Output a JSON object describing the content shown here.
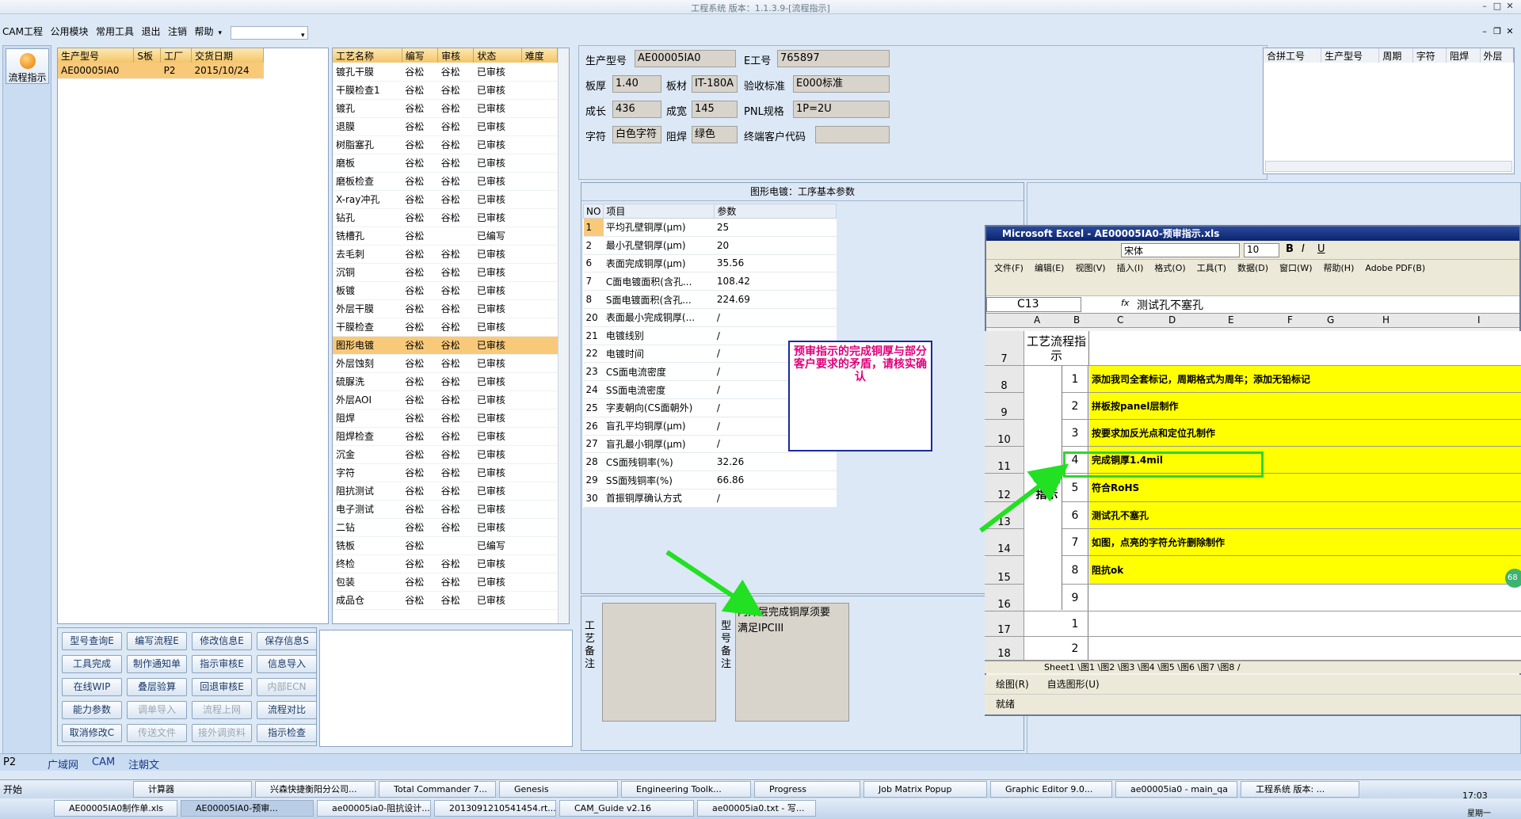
{
  "window": {
    "title": "工程系统 版本：1.1.3.9-[流程指示]"
  },
  "menu": {
    "items": [
      "CAM工程",
      "公用模块",
      "常用工具",
      "退出",
      "注销",
      "帮助"
    ]
  },
  "leftbar": {
    "flow_label": "流程指示"
  },
  "product_table": {
    "headers": [
      "生产型号",
      "S板",
      "工厂",
      "交货日期"
    ],
    "row": [
      "AE00005IA0",
      "",
      "P2",
      "2015/10/24"
    ]
  },
  "process_table": {
    "headers": [
      "工艺名称",
      "编写",
      "审核",
      "状态",
      "难度"
    ],
    "rows": [
      [
        "镀孔干膜",
        "谷松",
        "谷松",
        "已审核",
        ""
      ],
      [
        "干膜检查1",
        "谷松",
        "谷松",
        "已审核",
        ""
      ],
      [
        "镀孔",
        "谷松",
        "谷松",
        "已审核",
        ""
      ],
      [
        "退膜",
        "谷松",
        "谷松",
        "已审核",
        ""
      ],
      [
        "树脂塞孔",
        "谷松",
        "谷松",
        "已审核",
        ""
      ],
      [
        "磨板",
        "谷松",
        "谷松",
        "已审核",
        ""
      ],
      [
        "磨板检查",
        "谷松",
        "谷松",
        "已审核",
        ""
      ],
      [
        "X-ray冲孔",
        "谷松",
        "谷松",
        "已审核",
        ""
      ],
      [
        "钻孔",
        "谷松",
        "谷松",
        "已审核",
        ""
      ],
      [
        "铣槽孔",
        "谷松",
        "",
        "已编写",
        ""
      ],
      [
        "去毛刺",
        "谷松",
        "谷松",
        "已审核",
        ""
      ],
      [
        "沉铜",
        "谷松",
        "谷松",
        "已审核",
        ""
      ],
      [
        "板镀",
        "谷松",
        "谷松",
        "已审核",
        ""
      ],
      [
        "外层干膜",
        "谷松",
        "谷松",
        "已审核",
        ""
      ],
      [
        "干膜检查",
        "谷松",
        "谷松",
        "已审核",
        ""
      ],
      [
        "图形电镀",
        "谷松",
        "谷松",
        "已审核",
        ""
      ],
      [
        "外层蚀刻",
        "谷松",
        "谷松",
        "已审核",
        ""
      ],
      [
        "硫脲洗",
        "谷松",
        "谷松",
        "已审核",
        ""
      ],
      [
        "外层AOI",
        "谷松",
        "谷松",
        "已审核",
        ""
      ],
      [
        "阻焊",
        "谷松",
        "谷松",
        "已审核",
        ""
      ],
      [
        "阻焊检查",
        "谷松",
        "谷松",
        "已审核",
        ""
      ],
      [
        "沉金",
        "谷松",
        "谷松",
        "已审核",
        ""
      ],
      [
        "字符",
        "谷松",
        "谷松",
        "已审核",
        ""
      ],
      [
        "阻抗测试",
        "谷松",
        "谷松",
        "已审核",
        ""
      ],
      [
        "电子测试",
        "谷松",
        "谷松",
        "已审核",
        ""
      ],
      [
        "二钻",
        "谷松",
        "谷松",
        "已审核",
        ""
      ],
      [
        "铣板",
        "谷松",
        "",
        "已编写",
        ""
      ],
      [
        "终检",
        "谷松",
        "谷松",
        "已审核",
        ""
      ],
      [
        "包装",
        "谷松",
        "谷松",
        "已审核",
        ""
      ],
      [
        "成品仓",
        "谷松",
        "谷松",
        "已审核",
        ""
      ]
    ],
    "selected_index": 15
  },
  "buttons": [
    [
      "型号查询E",
      "编写流程E",
      "修改信息E",
      "保存信息S"
    ],
    [
      "工具完成",
      "制作通知单",
      "指示审核E",
      "信息导入"
    ],
    [
      "在线WIP",
      "叠层验算",
      "回退审核E",
      "内部ECN"
    ],
    [
      "能力参数",
      "调单导入",
      "流程上网",
      "流程对比"
    ],
    [
      "取消修改C",
      "传送文件",
      "接外调资料",
      "指示检查"
    ]
  ],
  "disabled_buttons": [
    "内部ECN",
    "调单导入",
    "流程上网",
    "传送文件",
    "接外调资料"
  ],
  "info": {
    "prod_label": "生产型号",
    "prod": "AE00005IA0",
    "e_label": "E工号",
    "e": "765897",
    "thick_label": "板厚",
    "thick": "1.40",
    "mat_label": "板材",
    "mat": "IT-180A",
    "std_label": "验收标准",
    "std": "E000标准",
    "len_label": "成长",
    "len": "436",
    "wid_label": "成宽",
    "wid": "145",
    "pnl_label": "PNL规格",
    "pnl": "1P=2U",
    "char_label": "字符",
    "char": "白色字符",
    "mask_label": "阻焊",
    "mask": "绿色",
    "cust_label": "终端客户代码",
    "cust": ""
  },
  "merge_table": {
    "headers": [
      "合拼工号",
      "生产型号",
      "周期",
      "字符",
      "阻焊",
      "外层"
    ]
  },
  "param_panel": {
    "title": "图形电镀：工序基本参数",
    "headers": [
      "NO",
      "项目",
      "参数"
    ],
    "rows": [
      [
        "1",
        "平均孔壁铜厚(μm)",
        "25"
      ],
      [
        "2",
        "最小孔壁铜厚(μm)",
        "20"
      ],
      [
        "6",
        "表面完成铜厚(μm)",
        "35.56"
      ],
      [
        "7",
        "C面电镀面积(含孔...",
        "108.42"
      ],
      [
        "8",
        "S面电镀面积(含孔...",
        "224.69"
      ],
      [
        "20",
        "表面最小完成铜厚(...",
        "/"
      ],
      [
        "21",
        "电镀线别",
        "/"
      ],
      [
        "22",
        "电镀时间",
        "/"
      ],
      [
        "23",
        "CS面电流密度",
        "/"
      ],
      [
        "24",
        "SS面电流密度",
        "/"
      ],
      [
        "25",
        "字麦朝向(CS面朝外)",
        "/"
      ],
      [
        "26",
        "盲孔平均铜厚(μm)",
        "/"
      ],
      [
        "27",
        "盲孔最小铜厚(μm)",
        "/"
      ],
      [
        "28",
        "CS面残铜率(%)",
        "32.26"
      ],
      [
        "29",
        "SS面残铜率(%)",
        "66.86"
      ],
      [
        "30",
        "首振铜厚确认方式",
        "/"
      ]
    ]
  },
  "annotation": {
    "text": "预审指示的完成铜厚与部分客户要求的矛盾，请核实确认",
    "color": "#e0007a"
  },
  "remarks": {
    "process_label": "工艺备注",
    "model_label": "型号备注",
    "model_text": "内外层完成铜厚须要满足IPCIII"
  },
  "excel": {
    "title": "Microsoft Excel - AE00005IA0-预审指示.xls",
    "font": "宋体",
    "size": "10",
    "menu": [
      "文件(F)",
      "编辑(E)",
      "视图(V)",
      "插入(I)",
      "格式(O)",
      "工具(T)",
      "数据(D)",
      "窗口(W)",
      "帮助(H)",
      "Adobe PDF(B)"
    ],
    "cellref": "C13",
    "formula": "测试孔不塞孔",
    "cols": [
      "A",
      "B",
      "C",
      "D",
      "E",
      "F",
      "G",
      "H",
      "I"
    ],
    "header_cell": "工艺流程指示",
    "cam_label": "CAM指示",
    "rows": [
      {
        "rn": "8",
        "num": "1",
        "text": "添加我司全套标记，周期格式为周年；添加无铅标记"
      },
      {
        "rn": "9",
        "num": "2",
        "text": "拼板按panel层制作"
      },
      {
        "rn": "10",
        "num": "3",
        "text": "按要求加反光点和定位孔制作"
      },
      {
        "rn": "11",
        "num": "4",
        "text": "完成铜厚1.4mil"
      },
      {
        "rn": "12",
        "num": "5",
        "text": "符合RoHS"
      },
      {
        "rn": "13",
        "num": "6",
        "text": "测试孔不塞孔"
      },
      {
        "rn": "14",
        "num": "7",
        "text": "如图，点亮的字符允许删除制作"
      },
      {
        "rn": "15",
        "num": "8",
        "text": "阻抗ok"
      },
      {
        "rn": "16",
        "num": "9",
        "text": ""
      },
      {
        "rn": "17",
        "num": "1",
        "text": ""
      },
      {
        "rn": "18",
        "num": "2",
        "text": ""
      }
    ],
    "sheets": "Sheet1 \\图1 \\图2 \\图3 \\图4 \\图5 \\图6 \\图7 \\图8 /",
    "draw_label": "绘图(R)",
    "autoshape": "自选图形(U)",
    "status": "就绪",
    "badge": "68"
  },
  "status": {
    "combo": "P2",
    "tabs": [
      "广域网",
      "CAM",
      "注朝文"
    ]
  },
  "taskbar": {
    "start": "开始",
    "row1": [
      "计算器",
      "兴森快捷衡阳分公司...",
      "Total Commander 7...",
      "Genesis",
      "Engineering Toolk...",
      "Progress",
      "Job Matrix Popup",
      "Graphic Editor 9.0...",
      "ae00005ia0 - main_qa",
      "工程系统  版本: ..."
    ],
    "row2": [
      "AE00005IA0制作单.xls",
      "AE00005IA0-预审...",
      "ae00005ia0-阻抗设计...",
      "2013091210541454.rt...",
      "CAM_Guide v2.16",
      "ae00005ia0.txt - 写..."
    ],
    "clock": "17:03",
    "day": "星期一"
  },
  "colors": {
    "arrow": "#22e022",
    "highlight": "#f9c97a",
    "note_border": "#1a2aa0"
  }
}
